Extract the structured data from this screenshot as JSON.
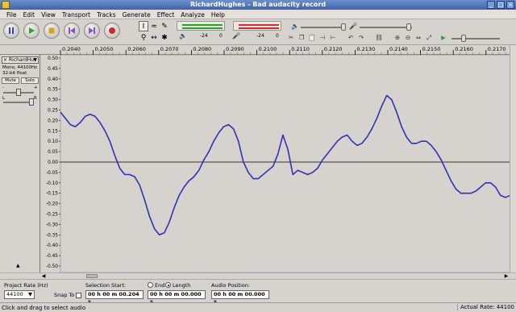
{
  "window": {
    "title": "RichardHughes - Bad audacity record"
  },
  "menu": [
    "File",
    "Edit",
    "View",
    "Transport",
    "Tracks",
    "Generate",
    "Effect",
    "Analyze",
    "Help"
  ],
  "meters": {
    "left_label": "-24",
    "left_label2": "0",
    "right_label": "-24",
    "right_label2": "0"
  },
  "ruler": {
    "ticks": [
      "0.2040",
      "0.2050",
      "0.2060",
      "0.2070",
      "0.2080",
      "0.2090",
      "0.2100",
      "0.2110",
      "0.2120",
      "0.2130",
      "0.2140",
      "0.2150",
      "0.2160",
      "0.2170"
    ]
  },
  "track": {
    "name": "RichardHu",
    "info1": "Mono, 44100Hz",
    "info2": "32-bit float",
    "mute_label": "Mute",
    "solo_label": "Solo",
    "gain_minus": "-",
    "gain_plus": "+",
    "pan_left": "L",
    "pan_right": "R",
    "scale": [
      "0.50",
      "0.45",
      "0.40",
      "0.35",
      "0.30",
      "0.25",
      "0.20",
      "0.15",
      "0.10",
      "0.05",
      "0.00",
      "-0.05",
      "-0.10",
      "-0.15",
      "-0.20",
      "-0.25",
      "-0.30",
      "-0.35",
      "-0.40",
      "-0.45",
      "-0.50"
    ]
  },
  "waveform": {
    "color": "#2e33b8",
    "background": "#d6d3ce",
    "samples": [
      0.24,
      0.21,
      0.18,
      0.17,
      0.19,
      0.22,
      0.23,
      0.22,
      0.19,
      0.15,
      0.1,
      0.03,
      -0.03,
      -0.06,
      -0.06,
      -0.07,
      -0.11,
      -0.18,
      -0.26,
      -0.32,
      -0.35,
      -0.34,
      -0.29,
      -0.22,
      -0.16,
      -0.12,
      -0.09,
      -0.07,
      -0.04,
      0.01,
      0.05,
      0.1,
      0.14,
      0.17,
      0.18,
      0.16,
      0.1,
      0.0,
      -0.05,
      -0.08,
      -0.08,
      -0.06,
      -0.04,
      -0.02,
      0.04,
      0.13,
      0.06,
      -0.06,
      -0.04,
      -0.05,
      -0.06,
      -0.05,
      -0.03,
      0.01,
      0.04,
      0.07,
      0.1,
      0.12,
      0.13,
      0.1,
      0.08,
      0.09,
      0.12,
      0.16,
      0.21,
      0.27,
      0.32,
      0.3,
      0.24,
      0.17,
      0.12,
      0.09,
      0.09,
      0.1,
      0.1,
      0.08,
      0.05,
      0.01,
      -0.04,
      -0.09,
      -0.13,
      -0.15,
      -0.15,
      -0.15,
      -0.14,
      -0.12,
      -0.1,
      -0.1,
      -0.12,
      -0.16,
      -0.17,
      -0.16
    ]
  },
  "selection": {
    "project_rate_label": "Project Rate (Hz)",
    "project_rate": "44100",
    "snap_label": "Snap To",
    "selection_start_label": "Selection Start:",
    "end_label": "End",
    "length_label": "Length",
    "audio_position_label": "Audio Position:",
    "start_value": "00 h 00 m 00.204 s",
    "length_value": "00 h 00 m 00.000 s",
    "position_value": "00 h 00 m 00.000 s"
  },
  "status": {
    "left": "Click and drag to select audio",
    "right": "Actual Rate: 44100"
  },
  "colors": {
    "title_bg": "#4a6fb5",
    "wave": "#2e33b8",
    "zero_line": "#000000"
  }
}
